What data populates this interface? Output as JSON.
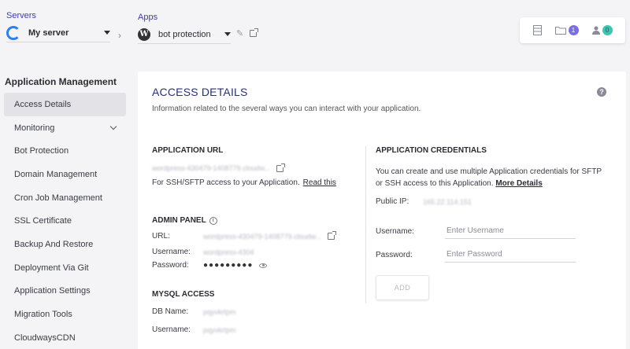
{
  "servers": {
    "label": "Servers",
    "selected": "My server"
  },
  "apps": {
    "label": "Apps",
    "selected": "bot protection"
  },
  "toolbar": {
    "files_count": "1",
    "users_count": "0"
  },
  "sidebar": {
    "title": "Application Management",
    "items": [
      {
        "label": "Access Details",
        "active": true
      },
      {
        "label": "Monitoring",
        "has_chevron": true
      },
      {
        "label": "Bot Protection"
      },
      {
        "label": "Domain Management"
      },
      {
        "label": "Cron Job Management"
      },
      {
        "label": "SSL Certificate"
      },
      {
        "label": "Backup And Restore"
      },
      {
        "label": "Deployment Via Git"
      },
      {
        "label": "Application Settings"
      },
      {
        "label": "Migration Tools"
      },
      {
        "label": "CloudwaysCDN"
      }
    ]
  },
  "main": {
    "title": "ACCESS DETAILS",
    "subtitle": "Information related to the several ways you can interact with your application.",
    "app_url": {
      "heading": "APPLICATION URL",
      "url": "wordpress-430479-1408779.cloudw...",
      "ssh_text": "For SSH/SFTP access to your Application.",
      "read_link": "Read this"
    },
    "admin_panel": {
      "heading": "ADMIN PANEL",
      "url_label": "URL:",
      "url_value": "wordpress-430479-1408779.cloudw...",
      "username_label": "Username:",
      "username_value": "wordpress-4304",
      "password_label": "Password:",
      "password_value": "●●●●●●●●●"
    },
    "mysql": {
      "heading": "MYSQL ACCESS",
      "db_label": "DB Name:",
      "db_value": "pqyvkrtpm",
      "username_label": "Username:",
      "username_value": "pqyvkrtpm"
    },
    "credentials": {
      "heading": "APPLICATION CREDENTIALS",
      "desc_line1": "You can create and use multiple Application credentials for SFTP",
      "desc_line2": "or SSH access to this Application.",
      "more_link": "More Details",
      "public_ip_label": "Public IP:",
      "public_ip_value": "165.22.114.151",
      "username_label": "Username:",
      "username_placeholder": "Enter Username",
      "password_label": "Password:",
      "password_placeholder": "Enter Password",
      "add_label": "ADD"
    }
  },
  "colors": {
    "accent": "#3b3bb0",
    "title": "#27307a",
    "badge_purple": "#7b6fdc",
    "badge_teal": "#3ec4b0"
  }
}
